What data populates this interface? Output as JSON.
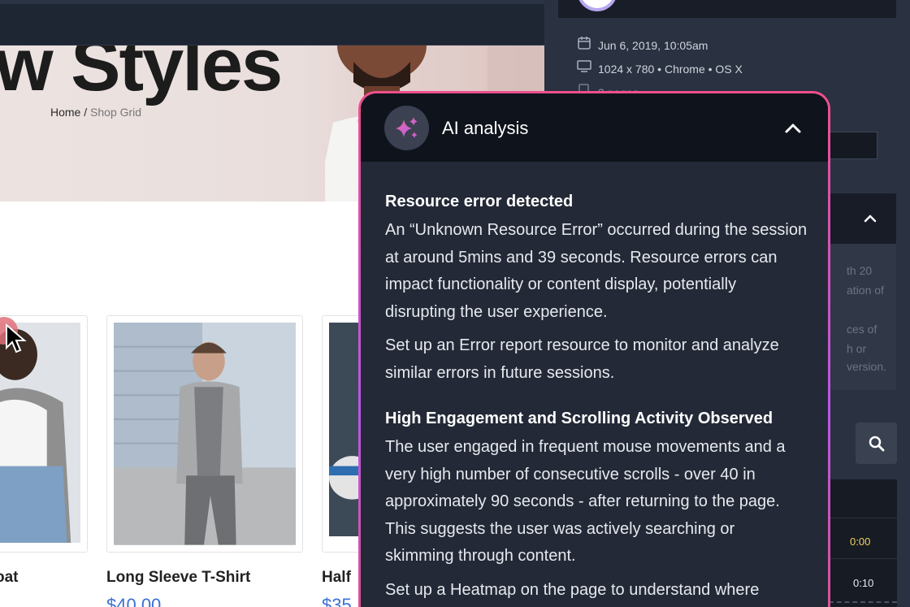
{
  "site": {
    "hero_title": "w Styles",
    "breadcrumb": {
      "home": "Home",
      "separator": " / ",
      "current": "Shop Grid"
    },
    "products": [
      {
        "title": "oat",
        "price": ""
      },
      {
        "title": "Long Sleeve T-Shirt",
        "price": "$40.00"
      },
      {
        "title": "Half",
        "price": "$35"
      }
    ]
  },
  "panel": {
    "meta": [
      {
        "icon": "calendar-icon",
        "text": "Jun 6, 2019, 10:05am"
      },
      {
        "icon": "monitor-icon",
        "text": "1024 x 780 • Chrome • OS X"
      },
      {
        "icon": "pages-icon",
        "text": "3 pages"
      }
    ],
    "faint_lines": [
      "th 20",
      "ation of",
      "",
      "ces of",
      "h or",
      "version."
    ],
    "timeline": {
      "times": [
        "0:00",
        "0:10"
      ]
    }
  },
  "ai": {
    "title": "AI analysis",
    "sections": [
      {
        "heading": "Resource error detected",
        "paragraphs": [
          "An “Unknown Resource Error” occurred during  the session at around 5mins and 39 seconds. Resource errors can impact functionality or content display, potentially disrupting the user experience.",
          "Set up an Error report resource to monitor and analyze similar errors in future sessions."
        ]
      },
      {
        "heading": "High Engagement and Scrolling Activity Observed",
        "paragraphs": [
          "The user engaged in frequent mouse movements and a very high number of consecutive scrolls - over 40 in approximately 90 seconds - after returning to the page. This suggests the user was actively searching or skimming through content.",
          "Set up a Heatmap on the page to understand where"
        ]
      }
    ]
  },
  "colors": {
    "accent_pink": "#ef4f8c",
    "accent_purple": "#b857e6",
    "price_blue": "#3b6fd6",
    "time_yellow": "#f2d15b"
  }
}
